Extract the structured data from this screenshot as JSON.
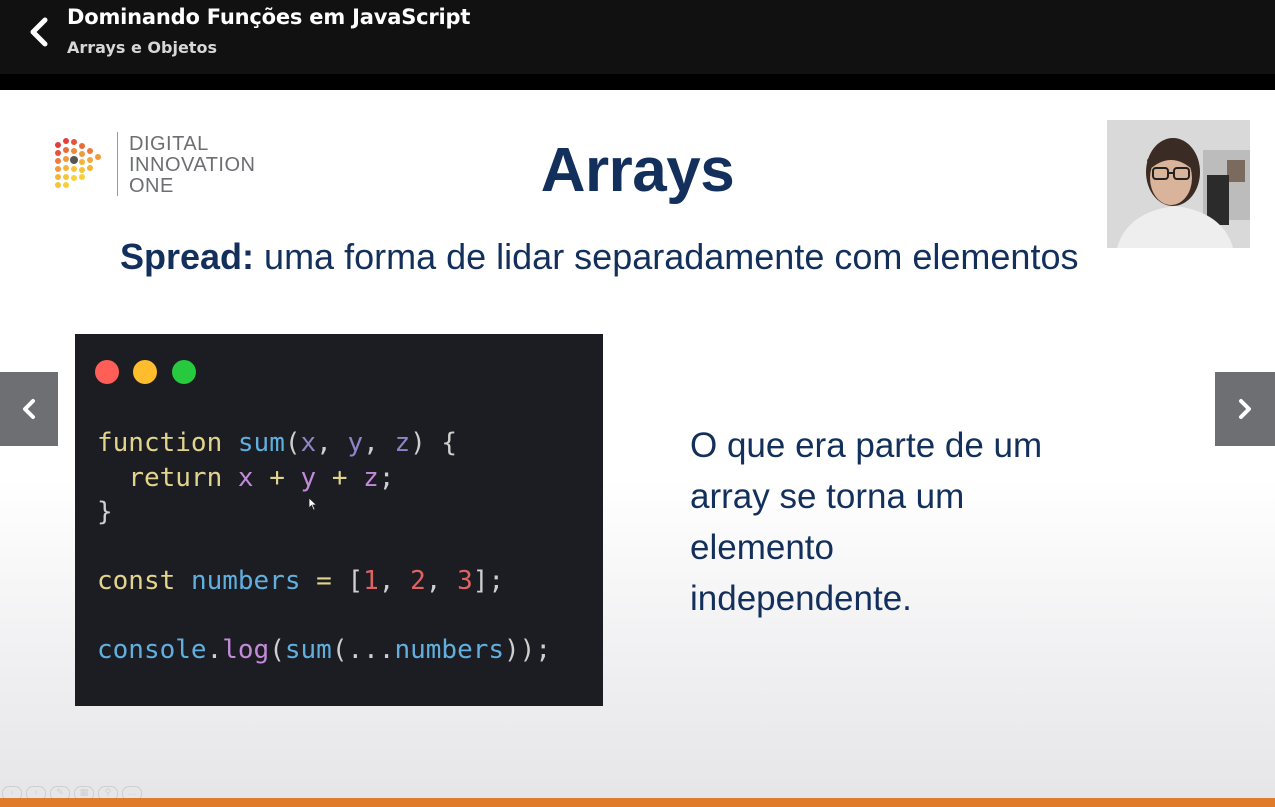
{
  "header": {
    "course_title": "Dominando Funções em JavaScript",
    "lesson_title": "Arrays e Objetos",
    "back_icon": "chevron-left-icon"
  },
  "slide": {
    "logo": {
      "line1": "DIGITAL",
      "line2": "INNOVATION",
      "line3": "ONE"
    },
    "title": "Arrays",
    "subtitle_bold": "Spread:",
    "subtitle_rest": " uma forma de lidar separadamente com elementos",
    "code_lines": [
      "function sum(x, y, z) {",
      "  return x + y + z;",
      "}",
      "",
      "const numbers = [1, 2, 3];",
      "",
      "console.log(sum(...numbers));"
    ],
    "description_lines": [
      "O que era parte de um",
      "array se torna um",
      "elemento",
      "independente."
    ]
  },
  "navigation": {
    "prev_icon": "chevron-left-icon",
    "next_icon": "chevron-right-icon"
  },
  "colors": {
    "title_navy": "#13305c",
    "progress_orange": "#e07b2c",
    "code_bg": "#1c1d22"
  }
}
